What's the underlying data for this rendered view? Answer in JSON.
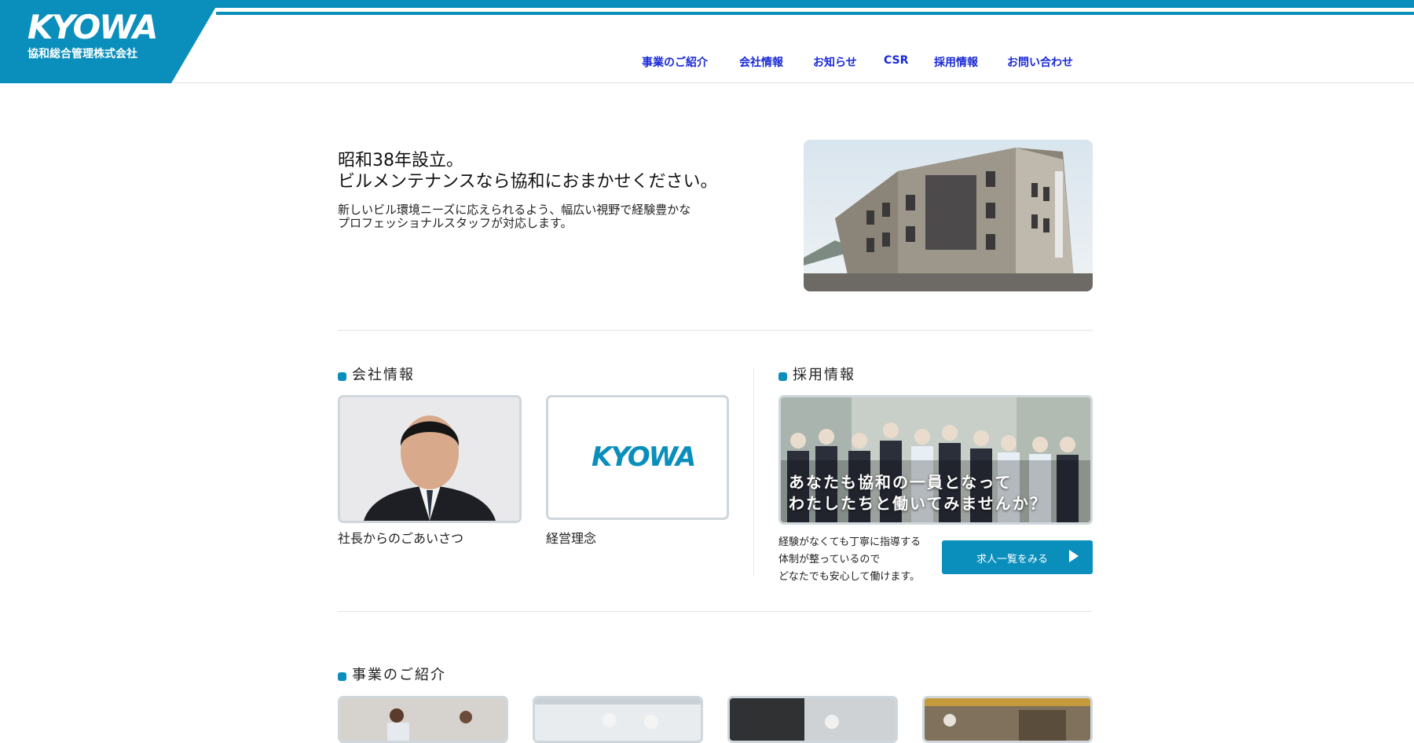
{
  "header": {
    "logo_text": "KYOWA",
    "logo_subtitle": "協和総合管理株式会社",
    "nav": [
      {
        "label": "事業のご紹介"
      },
      {
        "label": "会社情報"
      },
      {
        "label": "お知らせ"
      },
      {
        "label": "CSR"
      },
      {
        "label": "採用情報"
      },
      {
        "label": "お問い合わせ"
      }
    ]
  },
  "intro": {
    "title_line1": "昭和38年設立。",
    "title_line2": "ビルメンテナンスなら協和におまかせください。",
    "desc_line1": "新しいビル環境ニーズに応えられるよう、幅広い視野で経験豊かな",
    "desc_line2": "プロフェッショナルスタッフが対応します。"
  },
  "company": {
    "title": "会社情報",
    "cards": [
      {
        "caption": "社長からのごあいさつ"
      },
      {
        "caption": "経営理念",
        "logo_text": "KYOWA"
      }
    ]
  },
  "recruit": {
    "title": "採用情報",
    "overlay_line1": "あなたも協和の一員となって",
    "overlay_line2": "わたしたちと働いてみませんか？",
    "desc_line1": "経験がなくても丁寧に指導する",
    "desc_line2": "体制が整っているので",
    "desc_line3": "どなたでも安心して働けます。",
    "button_label": "求人一覧をみる"
  },
  "business": {
    "title": "事業のご紹介"
  },
  "colors": {
    "brand": "#0a8fbc",
    "nav_link": "#1a2ad6"
  }
}
